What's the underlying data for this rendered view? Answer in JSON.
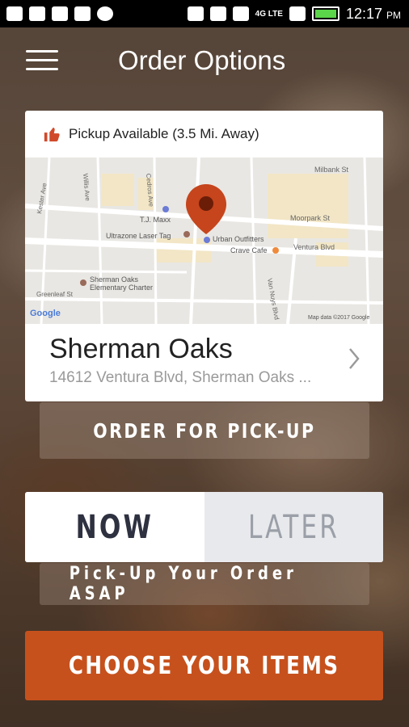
{
  "status_bar": {
    "time": "12:17",
    "ampm": "PM",
    "network": "4G LTE"
  },
  "header": {
    "title": "Order Options",
    "menu_icon": "hamburger-icon"
  },
  "location_card": {
    "pickup_label": "Pickup Available (3.5 Mi. Away)",
    "thumb_icon": "thumbs-up-icon",
    "map": {
      "labels": [
        "Milbank St",
        "Willis Ave",
        "Cedros Ave",
        "Moorpark St",
        "T.J. Maxx",
        "Ultrazone Laser Tag",
        "Urban Outfitters",
        "Crave Cafe",
        "Ventura Blvd",
        "Kester Ave",
        "Sherman Oaks",
        "Elementary Charter",
        "Greenleaf St",
        "Van Nuys Blvd",
        "Google",
        "Map data ©2017 Google"
      ]
    },
    "name": "Sherman Oaks",
    "address": "14612 Ventura Blvd, Sherman Oaks ..."
  },
  "pickup_button": {
    "label": "ORDER FOR PICK-UP"
  },
  "time_toggle": {
    "now_label": "NOW",
    "later_label": "LATER",
    "selected": "NOW"
  },
  "asap_text": "Pick-Up Your Order ASAP",
  "choose_button": {
    "label": "CHOOSE YOUR ITEMS"
  },
  "colors": {
    "accent": "#c6511d",
    "thumb": "#d0492a",
    "pin": "#c6451c"
  }
}
